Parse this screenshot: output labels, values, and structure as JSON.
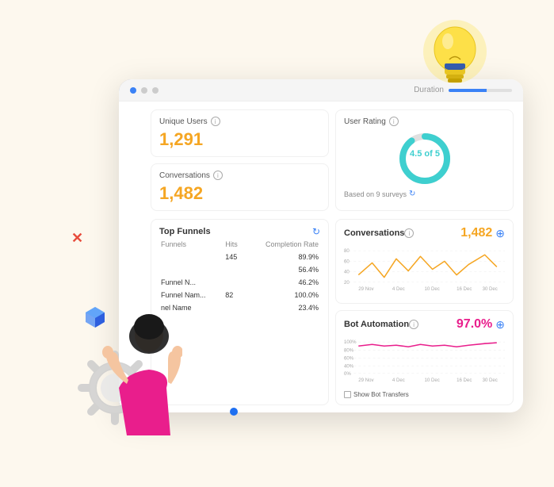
{
  "header": {
    "duration_label": "Duration",
    "nav_dots": [
      "active",
      "inactive",
      "inactive"
    ]
  },
  "metrics": {
    "unique_users_label": "Unique Users",
    "unique_users_value": "1,291",
    "conversations_label": "Conversations",
    "conversations_value": "1,482",
    "user_rating_label": "User Rating",
    "user_rating_value": "4.5 of 5",
    "rating_sub": "Based on 9 surveys",
    "conversations_chart_label": "Conversations",
    "conversations_chart_value": "1,482",
    "bot_automation_label": "Bot Automation",
    "bot_automation_value": "97.0%",
    "show_bot_transfers_label": "Show Bot Transfers"
  },
  "funnels": {
    "title": "Top Funnels",
    "columns": [
      "Funnels",
      "Hits",
      "Completion Rate"
    ],
    "rows": [
      {
        "name": "",
        "hits": "145",
        "rate": "89.9%"
      },
      {
        "name": "",
        "hits": "",
        "rate": "56.4%"
      },
      {
        "name": "Funnel N...",
        "hits": "",
        "rate": "46.2%"
      },
      {
        "name": "Funnel Nam...",
        "hits": "82",
        "rate": "100.0%"
      },
      {
        "name": "nel Name",
        "hits": "",
        "rate": "23.4%"
      }
    ]
  },
  "chart_dates": [
    "29 Nov",
    "4 Dec",
    "10 Dec",
    "16 Dec",
    "30 Dec"
  ],
  "chart_dates_bot": [
    "29 Nov",
    "4 Dec",
    "10 Dec",
    "16 Dec",
    "30 Dec"
  ],
  "conversations_y_labels": [
    "80",
    "60",
    "40",
    "20"
  ],
  "bot_y_labels": [
    "100%",
    "80%",
    "60%",
    "40%",
    "0%"
  ],
  "icons": {
    "info": "ℹ",
    "refresh": "↻",
    "arrow_right": "→",
    "checkbox": "□"
  }
}
